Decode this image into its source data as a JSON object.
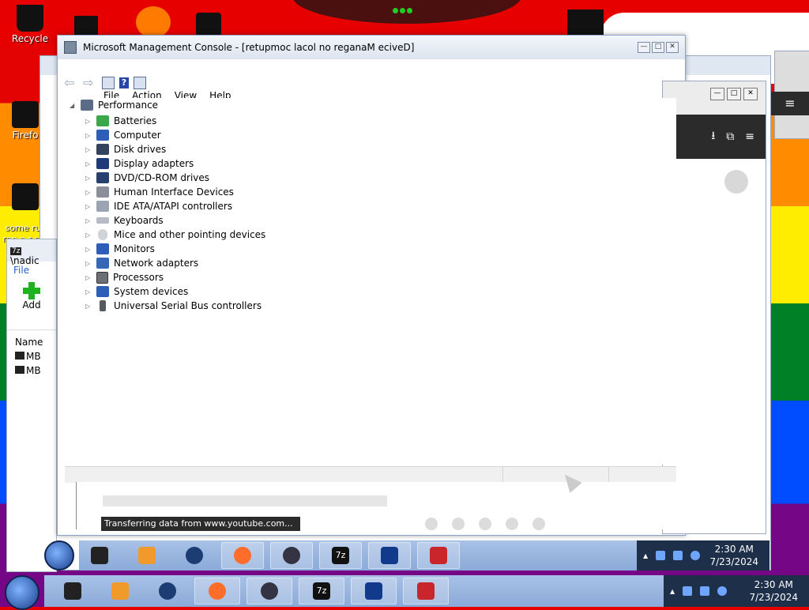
{
  "desktop": {
    "icons": [
      {
        "label": "Recycle",
        "id": "recycle"
      },
      {
        "label": "Firefo",
        "id": "firefox"
      },
      {
        "label": "some rus\nran a r sur e",
        "id": "script"
      }
    ]
  },
  "left_window": {
    "title": "\\nadic",
    "menu": "File",
    "add_label": "Add",
    "name_header": "Name",
    "rows": [
      "MB",
      "MB"
    ]
  },
  "mmc": {
    "title": "Microsoft Management Console - [retupmoc lacol no reganaM eciveD]",
    "menu": [
      "File",
      "Action",
      "View",
      "Help"
    ],
    "tree": {
      "root": "Performance",
      "items": [
        "Batteries",
        "Computer",
        "Disk drives",
        "Display adapters",
        "DVD/CD-ROM drives",
        "Human Interface Devices",
        "IDE ATA/ATAPI controllers",
        "Keyboards",
        "Mice and other pointing devices",
        "Monitors",
        "Network adapters",
        "Processors",
        "System devices",
        "Universal Serial Bus controllers"
      ]
    }
  },
  "browser_status": "Transferring data from www.youtube.com...",
  "taskbar": {
    "tasks": [
      "terminal",
      "media-player",
      "firefox-round",
      "firefox",
      "user-app",
      "7z",
      "device-app",
      "toolbox"
    ],
    "task_labels": {
      "sevenzip": "7z"
    },
    "clock_time": "2:30 AM",
    "clock_date": "7/23/2024"
  },
  "colors": {
    "taskbar": "#8aaad9",
    "tray": "#1e2f4a",
    "title_bar": "#dbe4f0",
    "desktop_red": "#e60000"
  }
}
